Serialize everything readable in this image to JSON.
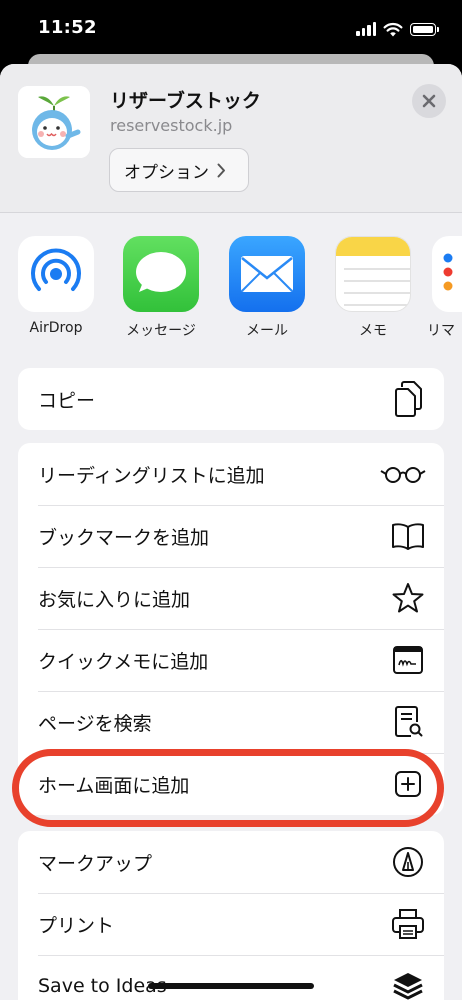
{
  "status_bar": {
    "time": "11:52"
  },
  "site": {
    "title": "リザーブストック",
    "domain": "reservestock.jp",
    "options_label": "オプション",
    "icon_kanji": "ω"
  },
  "apps": [
    {
      "label": "AirDrop",
      "icon": "airdrop-icon"
    },
    {
      "label": "メッセージ",
      "icon": "messages-icon"
    },
    {
      "label": "メール",
      "icon": "mail-icon"
    },
    {
      "label": "メモ",
      "icon": "notes-icon"
    },
    {
      "label": "リマ",
      "icon": "reminders-icon"
    }
  ],
  "actions": {
    "copy": "コピー",
    "reading_list": "リーディングリストに追加",
    "bookmark": "ブックマークを追加",
    "favorites": "お気に入りに追加",
    "quick_note": "クイックメモに追加",
    "find_on_page": "ページを検索",
    "add_to_home": "ホーム画面に追加",
    "markup": "マークアップ",
    "print": "プリント",
    "save_to_ideas": "Save to Ideas"
  },
  "colors": {
    "highlight": "#e8412c",
    "messages_green": "#4cd964",
    "mail_blue": "#1b8cf7",
    "notes_yellow": "#f9d547"
  }
}
